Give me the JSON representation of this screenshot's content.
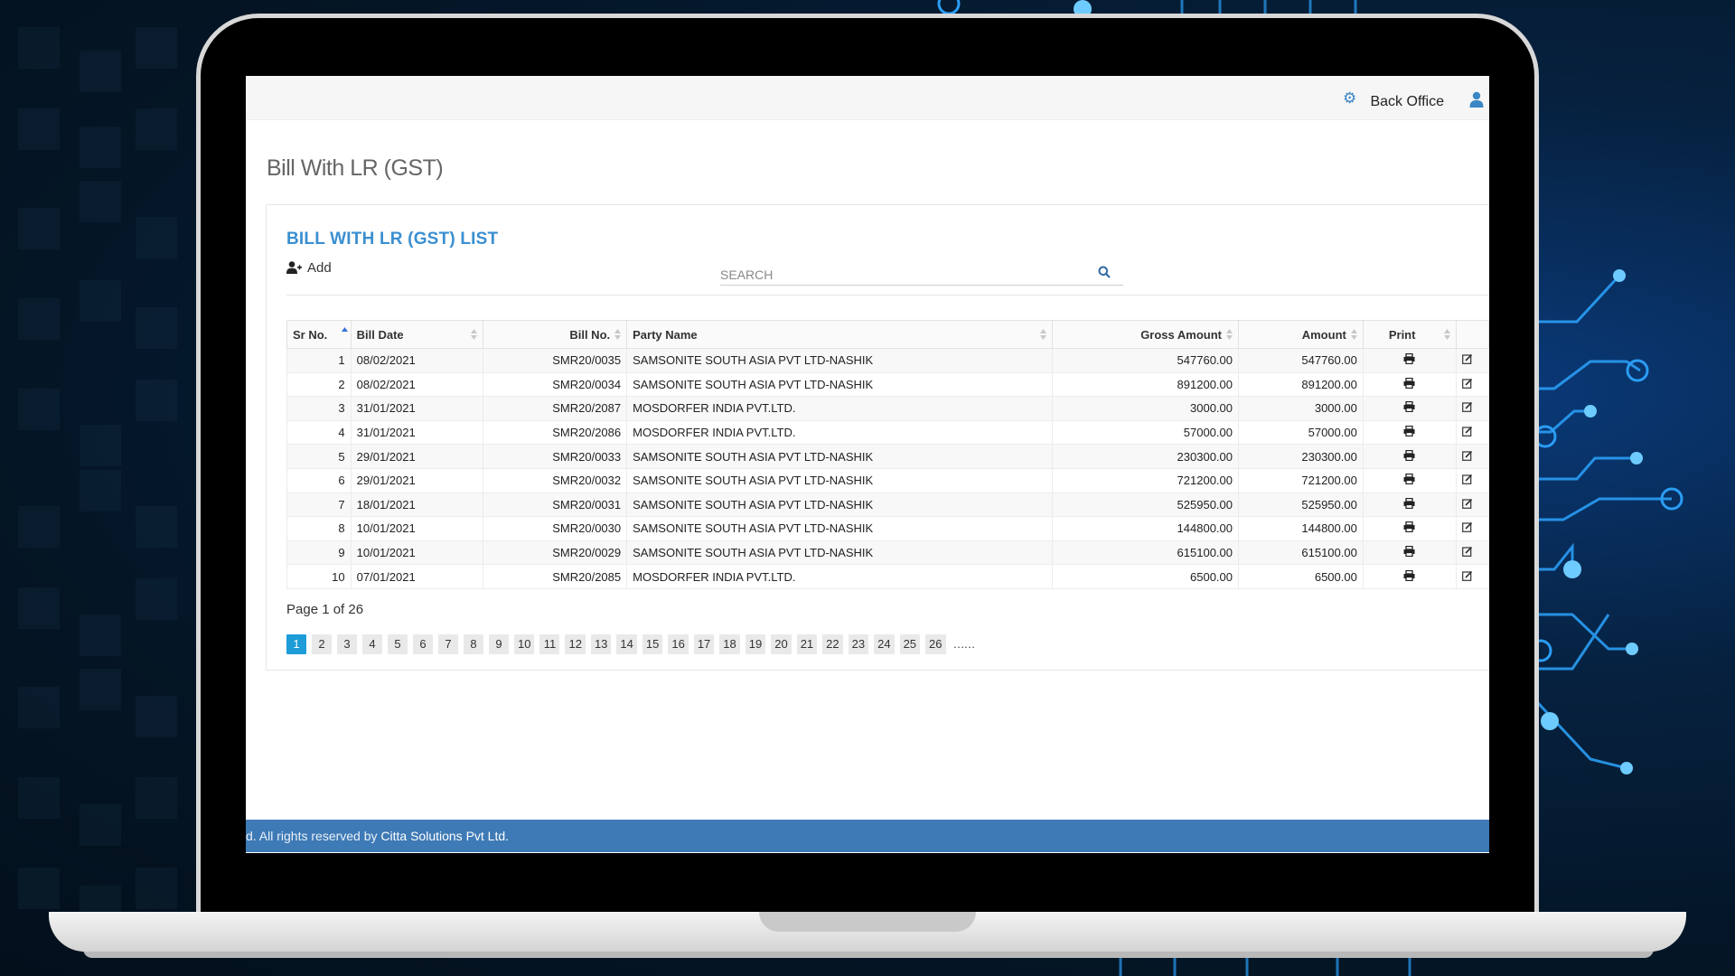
{
  "topbar": {
    "settings_icon": "gear-icon",
    "back_office": "Back Office",
    "user_icon": "user-icon"
  },
  "page": {
    "title": "Bill With LR (GST)"
  },
  "list": {
    "title": "BILL WITH LR (GST) LIST",
    "add_label": "Add",
    "search_placeholder": "SEARCH"
  },
  "table": {
    "headers": {
      "sr": "Sr No.",
      "date": "Bill Date",
      "bill_no": "Bill No.",
      "party": "Party Name",
      "gross": "Gross Amount",
      "amount": "Amount",
      "print": "Print"
    },
    "rows": [
      {
        "sr": "1",
        "date": "08/02/2021",
        "bill_no": "SMR20/0035",
        "party": "SAMSONITE SOUTH ASIA PVT LTD-NASHIK",
        "gross": "547760.00",
        "amount": "547760.00"
      },
      {
        "sr": "2",
        "date": "08/02/2021",
        "bill_no": "SMR20/0034",
        "party": "SAMSONITE SOUTH ASIA PVT LTD-NASHIK",
        "gross": "891200.00",
        "amount": "891200.00"
      },
      {
        "sr": "3",
        "date": "31/01/2021",
        "bill_no": "SMR20/2087",
        "party": "MOSDORFER INDIA PVT.LTD.",
        "gross": "3000.00",
        "amount": "3000.00"
      },
      {
        "sr": "4",
        "date": "31/01/2021",
        "bill_no": "SMR20/2086",
        "party": "MOSDORFER INDIA PVT.LTD.",
        "gross": "57000.00",
        "amount": "57000.00"
      },
      {
        "sr": "5",
        "date": "29/01/2021",
        "bill_no": "SMR20/0033",
        "party": "SAMSONITE SOUTH ASIA PVT LTD-NASHIK",
        "gross": "230300.00",
        "amount": "230300.00"
      },
      {
        "sr": "6",
        "date": "29/01/2021",
        "bill_no": "SMR20/0032",
        "party": "SAMSONITE SOUTH ASIA PVT LTD-NASHIK",
        "gross": "721200.00",
        "amount": "721200.00"
      },
      {
        "sr": "7",
        "date": "18/01/2021",
        "bill_no": "SMR20/0031",
        "party": "SAMSONITE SOUTH ASIA PVT LTD-NASHIK",
        "gross": "525950.00",
        "amount": "525950.00"
      },
      {
        "sr": "8",
        "date": "10/01/2021",
        "bill_no": "SMR20/0030",
        "party": "SAMSONITE SOUTH ASIA PVT LTD-NASHIK",
        "gross": "144800.00",
        "amount": "144800.00"
      },
      {
        "sr": "9",
        "date": "10/01/2021",
        "bill_no": "SMR20/0029",
        "party": "SAMSONITE SOUTH ASIA PVT LTD-NASHIK",
        "gross": "615100.00",
        "amount": "615100.00"
      },
      {
        "sr": "10",
        "date": "07/01/2021",
        "bill_no": "SMR20/2085",
        "party": "MOSDORFER INDIA PVT.LTD.",
        "gross": "6500.00",
        "amount": "6500.00"
      }
    ]
  },
  "pagination": {
    "info": "Page 1 of 26",
    "current": "1",
    "pages": [
      "1",
      "2",
      "3",
      "4",
      "5",
      "6",
      "7",
      "8",
      "9",
      "10",
      "11",
      "12",
      "13",
      "14",
      "15",
      "16",
      "17",
      "18",
      "19",
      "20",
      "21",
      "22",
      "23",
      "24",
      "25",
      "26"
    ],
    "more": "……"
  },
  "footer": {
    "text": "d. All rights reserved by ",
    "company": "Citta Solutions Pvt Ltd."
  },
  "colors": {
    "accent": "#3a8fd1",
    "footer": "#3e7ab5",
    "active_page": "#1d9cd8"
  }
}
